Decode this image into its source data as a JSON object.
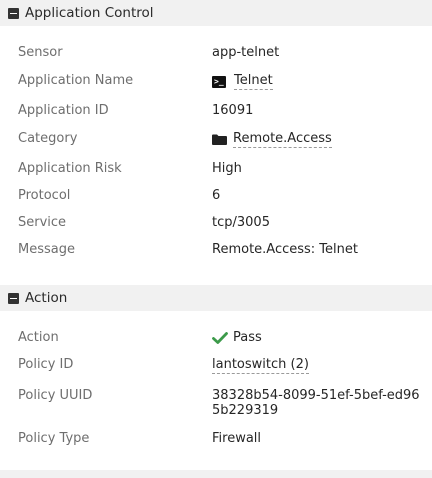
{
  "sections": {
    "app_control": {
      "title": "Application Control",
      "rows": {
        "sensor": {
          "label": "Sensor",
          "value": "app-telnet"
        },
        "app_name": {
          "label": "Application Name",
          "value": "Telnet"
        },
        "app_id": {
          "label": "Application ID",
          "value": "16091"
        },
        "category": {
          "label": "Category",
          "value": "Remote.Access"
        },
        "app_risk": {
          "label": "Application Risk",
          "value": "High"
        },
        "protocol": {
          "label": "Protocol",
          "value": "6"
        },
        "service": {
          "label": "Service",
          "value": "tcp/3005"
        },
        "message": {
          "label": "Message",
          "value": "Remote.Access: Telnet"
        }
      }
    },
    "action": {
      "title": "Action",
      "rows": {
        "action": {
          "label": "Action",
          "value": "Pass"
        },
        "policy_id": {
          "label": "Policy ID",
          "value": "lantoswitch (2)"
        },
        "policy_uuid": {
          "label": "Policy UUID",
          "value": "38328b54-8099-51ef-5bef-ed965b229319"
        },
        "policy_type": {
          "label": "Policy Type",
          "value": "Firewall"
        }
      }
    }
  },
  "icons": {
    "collapse": "minus-square-icon",
    "app": "terminal-icon",
    "category": "folder-icon",
    "action": "check-icon"
  },
  "colors": {
    "header_bg": "#f1f1f1",
    "label": "#6e6e6e",
    "value": "#262626",
    "pass_check": "#3c9a4a"
  }
}
